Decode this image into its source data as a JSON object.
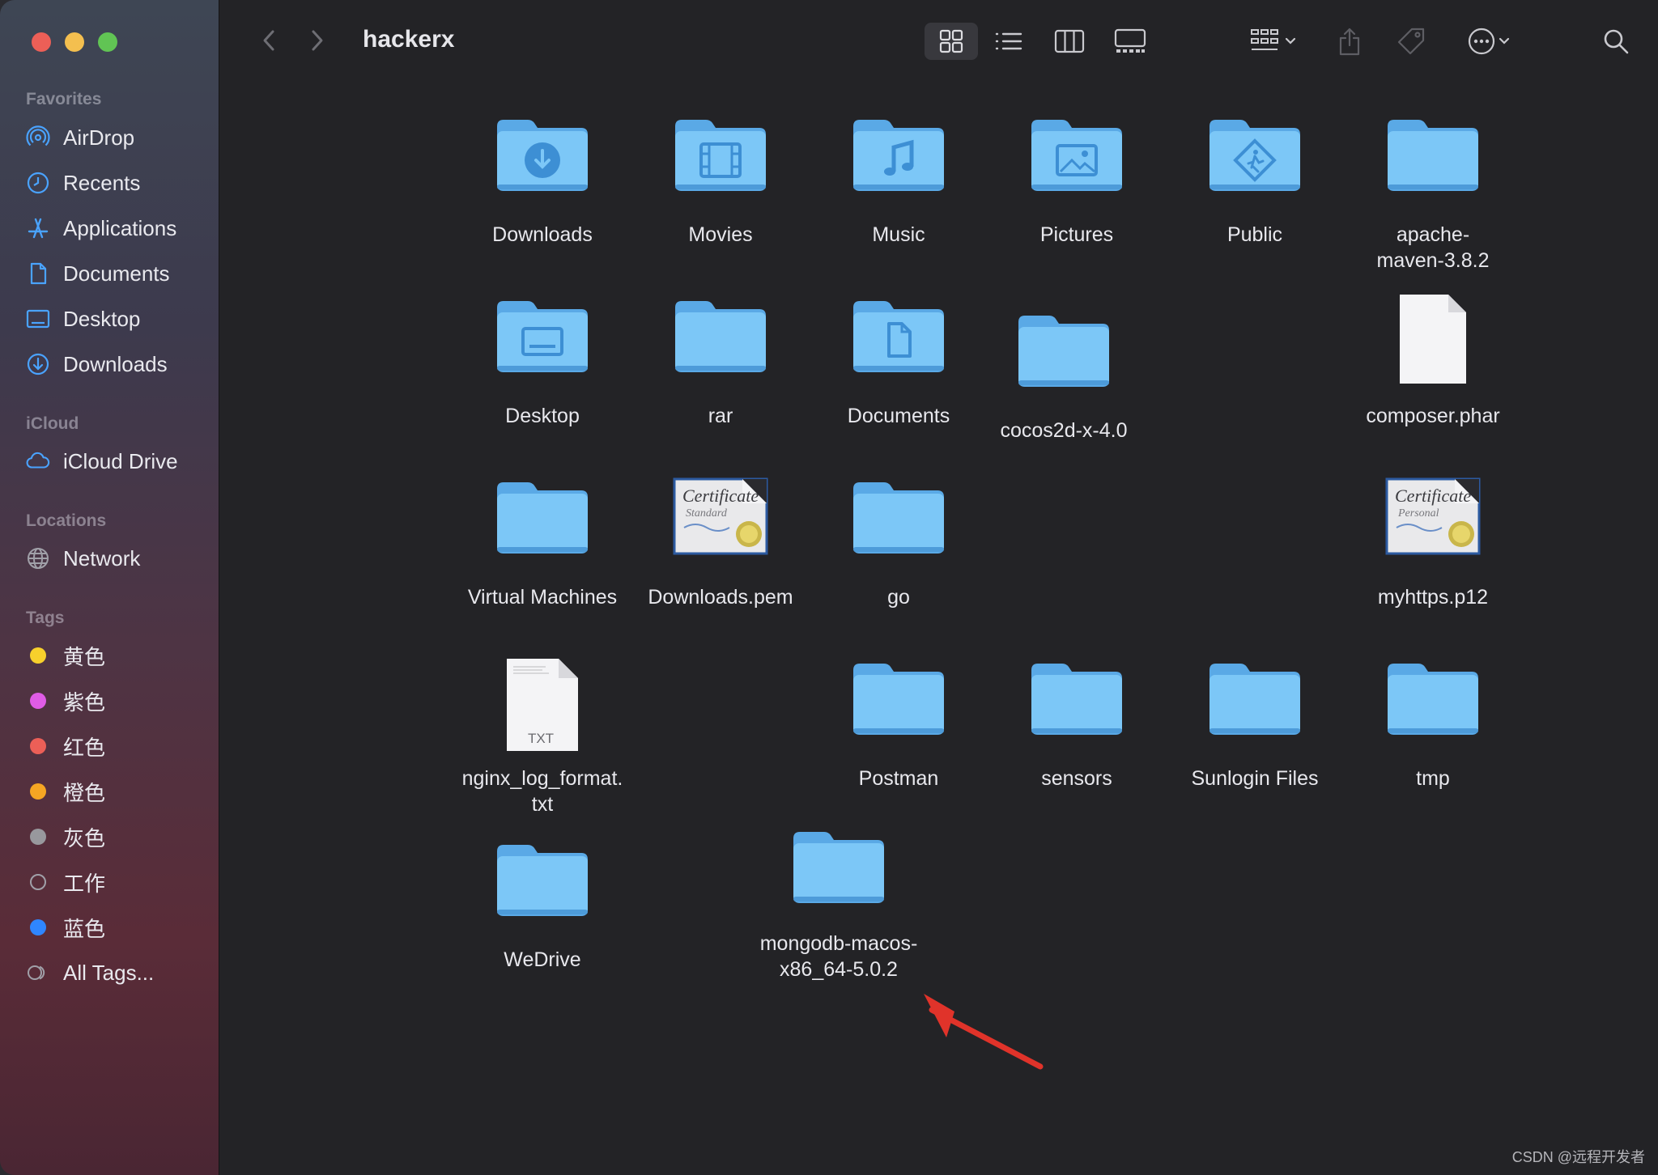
{
  "window": {
    "title": "hackerx"
  },
  "sidebar": {
    "favorites_header": "Favorites",
    "favorites": [
      {
        "label": "AirDrop",
        "icon": "airdrop-icon"
      },
      {
        "label": "Recents",
        "icon": "clock-icon"
      },
      {
        "label": "Applications",
        "icon": "applications-icon"
      },
      {
        "label": "Documents",
        "icon": "document-icon"
      },
      {
        "label": "Desktop",
        "icon": "desktop-icon"
      },
      {
        "label": "Downloads",
        "icon": "download-icon"
      }
    ],
    "icloud_header": "iCloud",
    "icloud": [
      {
        "label": "iCloud Drive",
        "icon": "cloud-icon"
      }
    ],
    "locations_header": "Locations",
    "locations": [
      {
        "label": "Network",
        "icon": "globe-icon"
      }
    ],
    "tags_header": "Tags",
    "tags": [
      {
        "label": "黄色",
        "color": "#f7d02c"
      },
      {
        "label": "紫色",
        "color": "#e05ce6"
      },
      {
        "label": "红色",
        "color": "#ec5f57"
      },
      {
        "label": "橙色",
        "color": "#f5a623"
      },
      {
        "label": "灰色",
        "color": "#98989d"
      },
      {
        "label": "工作",
        "color": ""
      },
      {
        "label": "蓝色",
        "color": "#2f86ff"
      },
      {
        "label": "All Tags...",
        "color": ""
      }
    ]
  },
  "toolbar": {
    "buttons": [
      "icon-view",
      "list-view",
      "column-view",
      "gallery-view",
      "group-by",
      "share",
      "tags",
      "action",
      "search"
    ]
  },
  "files": [
    {
      "name": "Downloads",
      "kind": "folder",
      "glyph": "download"
    },
    {
      "name": "Movies",
      "kind": "folder",
      "glyph": "film"
    },
    {
      "name": "Music",
      "kind": "folder",
      "glyph": "music"
    },
    {
      "name": "Pictures",
      "kind": "folder",
      "glyph": "picture"
    },
    {
      "name": "Public",
      "kind": "folder",
      "glyph": "public"
    },
    {
      "name": "apache-\nmaven-3.8.2",
      "kind": "folder",
      "glyph": ""
    },
    {
      "name": "Desktop",
      "kind": "folder",
      "glyph": "desktop"
    },
    {
      "name": "rar",
      "kind": "folder",
      "glyph": ""
    },
    {
      "name": "Documents",
      "kind": "folder",
      "glyph": "document"
    },
    {
      "name": "cocos2d-x-4.0",
      "kind": "folder",
      "glyph": ""
    },
    {
      "name": "composer.phar",
      "kind": "file",
      "glyph": ""
    },
    {
      "name": "Virtual Machines",
      "kind": "folder",
      "glyph": ""
    },
    {
      "name": "Downloads.pem",
      "kind": "certificate",
      "glyph": "Certificate",
      "sub": "Standard"
    },
    {
      "name": "go",
      "kind": "folder",
      "glyph": ""
    },
    {
      "name": "myhttps.p12",
      "kind": "certificate",
      "glyph": "Certificate",
      "sub": "Personal"
    },
    {
      "name": "nginx_log_format.\ntxt",
      "kind": "txt",
      "glyph": "TXT"
    },
    {
      "name": "Postman",
      "kind": "folder",
      "glyph": ""
    },
    {
      "name": "sensors",
      "kind": "folder",
      "glyph": ""
    },
    {
      "name": "Sunlogin Files",
      "kind": "folder",
      "glyph": ""
    },
    {
      "name": "tmp",
      "kind": "folder",
      "glyph": ""
    },
    {
      "name": "WeDrive",
      "kind": "folder",
      "glyph": ""
    },
    {
      "name": "mongodb-macos-\nx86_64-5.0.2",
      "kind": "folder",
      "glyph": ""
    }
  ],
  "annotation": {
    "color": "#e0332a"
  },
  "watermark": "CSDN @远程开发者"
}
